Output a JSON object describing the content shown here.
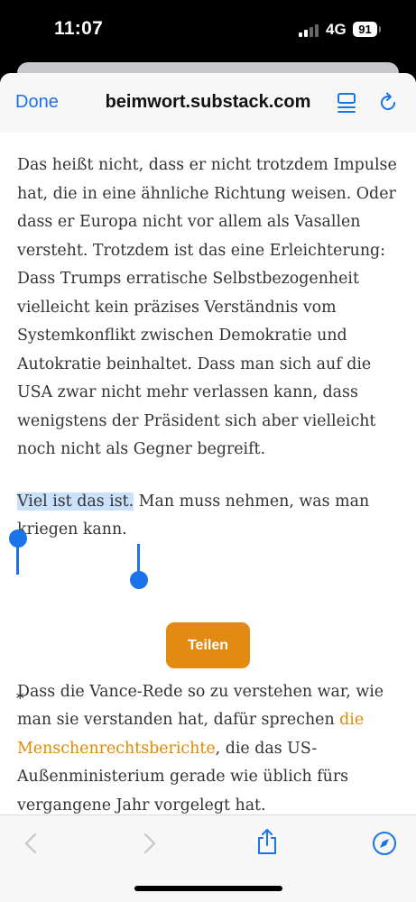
{
  "status_bar": {
    "time": "11:07",
    "network": "4G",
    "battery": "91"
  },
  "nav": {
    "done_label": "Done",
    "url": "beimwort.substack.com",
    "reader_icon": "reader-view-icon",
    "reload_icon": "reload-icon"
  },
  "article": {
    "p1": "Das heißt nicht, dass er nicht trotzdem Impulse hat, die in eine ähnliche Richtung weisen. Oder dass er Europa nicht vor allem als Vasallen versteht. Trotzdem ist das eine Erleichterung: Dass Trumps erratische Selbstbezogenheit vielleicht kein präzises Verständnis vom Systemkonflikt zwischen Demokratie und Autokratie beinhaltet. Dass man sich auf die USA zwar nicht mehr verlassen kann, dass wenigstens der Präsident sich aber vielleicht noch nicht als Gegner begreift.",
    "p2_selected": "Viel ist das ist.",
    "p2_rest": " Man muss nehmen, was man kriegen kann.",
    "share_label": "Teilen",
    "separator": "*",
    "p3_before": "Dass die Vance-Rede so zu verstehen war, wie man sie verstanden hat, dafür sprechen ",
    "p3_link": "die Menschenrechtsberichte",
    "p3_after": ", die das US-Außenministerium gerade wie üblich fürs vergangene Jahr vorgelegt hat."
  },
  "toolbar": {
    "back_icon": "chevron-left-icon",
    "forward_icon": "chevron-right-icon",
    "share_icon": "share-icon",
    "safari_icon": "compass-icon"
  },
  "colors": {
    "accent": "#1a73e8",
    "share_button": "#e38a12",
    "link": "#e08a00",
    "selection": "#cbe1fb"
  }
}
